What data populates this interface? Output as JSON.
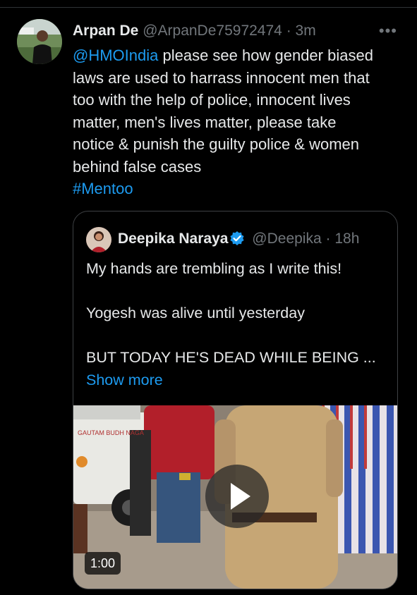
{
  "tweet": {
    "display_name": "Arpan De",
    "handle": "@ArpanDe75972474",
    "separator": "·",
    "time": "3m",
    "more_icon": "more-horizontal-icon",
    "text_lines": [
      {
        "link": "@HMOIndia",
        "text": " please see how gender biased"
      },
      {
        "text": "laws are used to harrass innocent men that"
      },
      {
        "text": "too with the help of police, innocent lives"
      },
      {
        "text": "matter, men's lives matter, please take"
      },
      {
        "text": "notice & punish the guilty police & women"
      },
      {
        "text": "behind false cases"
      }
    ],
    "hashtag": "#Mentoo"
  },
  "quoted": {
    "display_name": "Deepika Naraya",
    "verified_icon": "verified-badge-icon",
    "handle": "@Deepika",
    "separator": "·",
    "time": "18h",
    "line1": "My hands are trembling as I write this!",
    "line2": "Yogesh was alive until yesterday",
    "line3": "BUT TODAY HE'S DEAD WHILE BEING ...",
    "show_more": "Show more",
    "video": {
      "duration": "1:00",
      "vehicle_text": "GAUTAM BUDH NAGA",
      "play_icon": "play-icon"
    }
  },
  "colors": {
    "background": "#000000",
    "text": "#e7e9ea",
    "muted": "#71767b",
    "link": "#1d9bf0",
    "border": "#3e4144"
  }
}
